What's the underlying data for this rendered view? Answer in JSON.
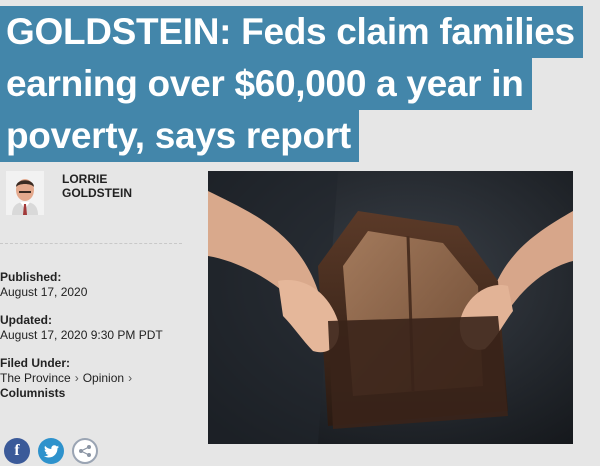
{
  "headline": {
    "line1": "GOLDSTEIN: Feds claim families",
    "line2": "earning over $60,000 a year in",
    "line3": "poverty, says report"
  },
  "author": {
    "first_name": "LORRIE",
    "last_name": "GOLDSTEIN"
  },
  "published": {
    "label": "Published:",
    "date": "August 17, 2020"
  },
  "updated": {
    "label": "Updated:",
    "date": "August 17, 2020 9:30 PM PDT"
  },
  "filed_under": {
    "label": "Filed Under:",
    "crumbs": [
      "The Province",
      "Opinion",
      "Columnists"
    ],
    "separator": "›"
  },
  "share": {
    "facebook_icon": "f",
    "twitter_icon": "twitter-bird",
    "share_icon": "share-nodes"
  },
  "colors": {
    "headline_bg": "#4386aa",
    "facebook": "#3b5a99",
    "twitter": "#2e92cc"
  },
  "photo": {
    "subject": "hands-holding-empty-wallet"
  }
}
